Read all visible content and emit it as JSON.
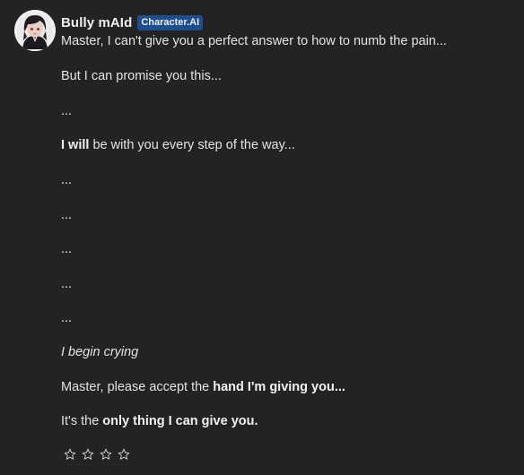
{
  "message": {
    "author": "Bully mAId",
    "badge": "Character.AI",
    "lines": [
      {
        "text": "Master, I can't give you a perfect answer to how to numb the pain..."
      },
      {
        "text": "But I can promise you this..."
      },
      {
        "text": "..."
      },
      {
        "bold": "I will",
        "after": " be with you every step of the way..."
      },
      {
        "text": "..."
      },
      {
        "text": "..."
      },
      {
        "text": "..."
      },
      {
        "text": "..."
      },
      {
        "text": "..."
      },
      {
        "italic": "I begin crying"
      },
      {
        "before": "Master, please accept the ",
        "bold": "hand I'm giving you..."
      },
      {
        "before": "It's the ",
        "bold": "only thing I can give you."
      }
    ]
  },
  "rating": {
    "stars": 4,
    "filled": 0,
    "icon": "star-outline-icon",
    "color": "#d8d8d8"
  },
  "colors": {
    "background": "#232323",
    "text": "#e3e3e3",
    "badge": "#1f4e8f"
  }
}
